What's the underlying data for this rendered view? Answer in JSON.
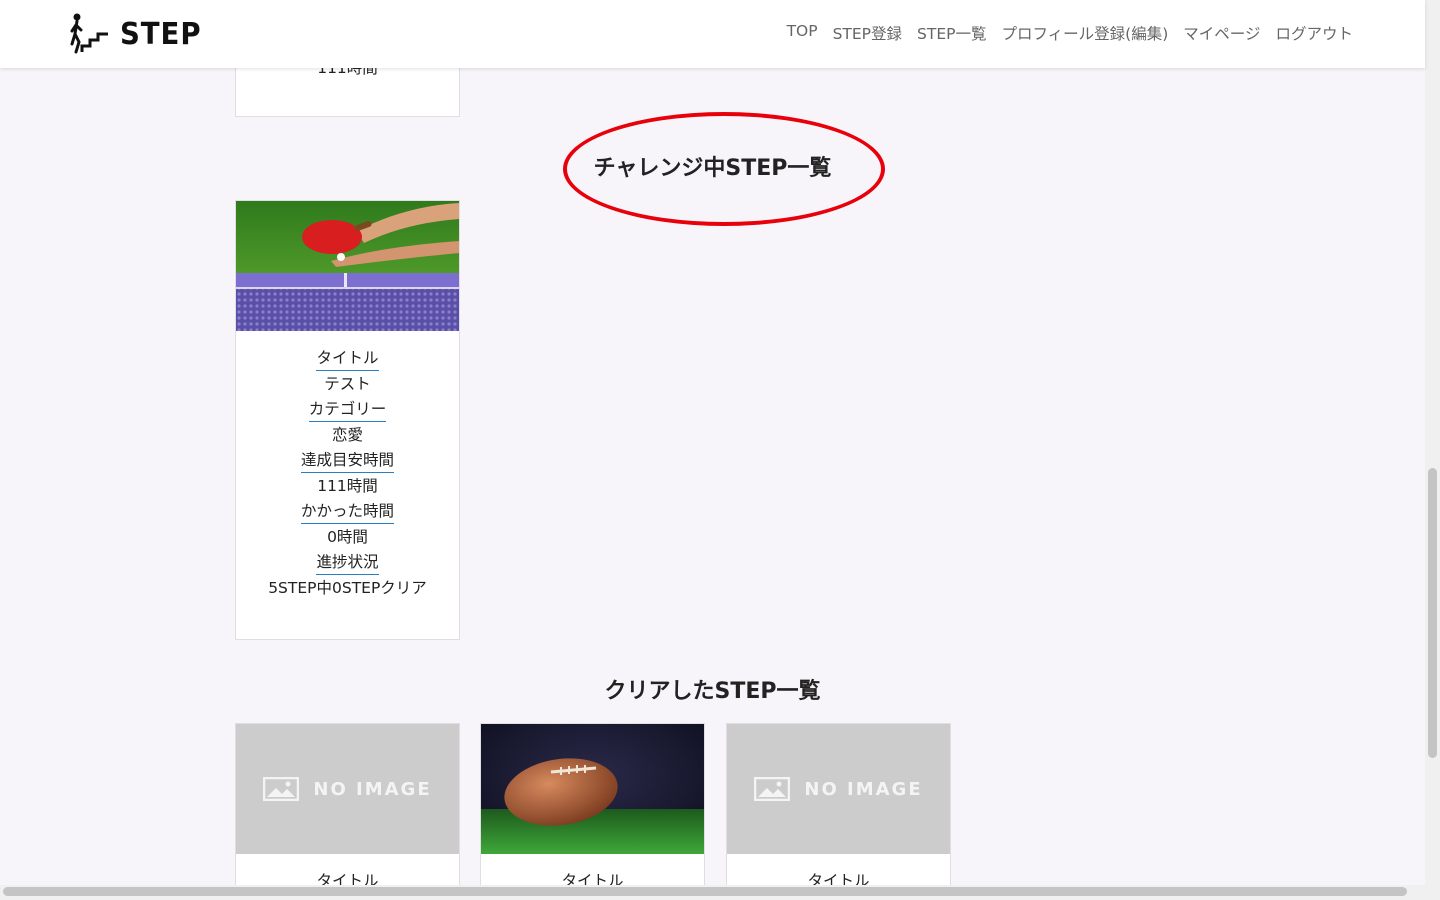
{
  "header": {
    "logo_text": "STEP",
    "nav": [
      "TOP",
      "STEP登録",
      "STEP一覧",
      "プロフィール登録(編集)",
      "マイページ",
      "ログアウト"
    ]
  },
  "top_card": {
    "partial_value": "111時間"
  },
  "challenge_section": {
    "title": "チャレンジ中STEP一覧",
    "cards": [
      {
        "image": "table-tennis-photo",
        "fields": [
          {
            "label": "タイトル",
            "value": "テスト"
          },
          {
            "label": "カテゴリー",
            "value": "恋愛"
          },
          {
            "label": "達成目安時間",
            "value": "111時間"
          },
          {
            "label": "かかった時間",
            "value": "0時間"
          },
          {
            "label": "進捗状況",
            "value": "5STEP中0STEPクリア"
          }
        ]
      }
    ]
  },
  "cleared_section": {
    "title": "クリアしたSTEP一覧",
    "cards": [
      {
        "image": "no-image",
        "no_image_text": "NO IMAGE",
        "title_label": "タイトル"
      },
      {
        "image": "football-photo",
        "title_label": "タイトル"
      },
      {
        "image": "no-image",
        "no_image_text": "NO IMAGE",
        "title_label": "タイトル"
      }
    ]
  },
  "colors": {
    "annotation": "#e8000b",
    "label_underline": "#2a7fc0",
    "background": "#f7f5fa"
  }
}
